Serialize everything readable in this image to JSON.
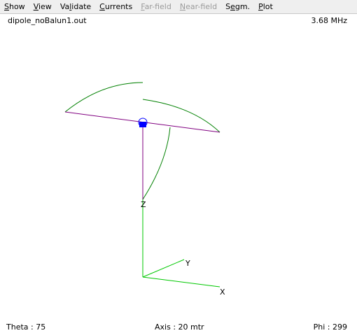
{
  "menu": [
    {
      "pre": "",
      "key": "S",
      "post": "how",
      "enabled": true,
      "name": "menu-show"
    },
    {
      "pre": "",
      "key": "V",
      "post": "iew",
      "enabled": true,
      "name": "menu-view"
    },
    {
      "pre": "Va",
      "key": "l",
      "post": "idate",
      "enabled": true,
      "name": "menu-validate"
    },
    {
      "pre": "",
      "key": "C",
      "post": "urrents",
      "enabled": true,
      "name": "menu-currents"
    },
    {
      "pre": "",
      "key": "F",
      "post": "ar-field",
      "enabled": false,
      "name": "menu-far-field"
    },
    {
      "pre": "",
      "key": "N",
      "post": "ear-field",
      "enabled": false,
      "name": "menu-near-field"
    },
    {
      "pre": "S",
      "key": "e",
      "post": "gm.",
      "enabled": true,
      "name": "menu-segm"
    },
    {
      "pre": "",
      "key": "P",
      "post": "lot",
      "enabled": true,
      "name": "menu-plot"
    }
  ],
  "header": {
    "file_name": "dipole_noBalun1.out",
    "frequency": "3.68 MHz"
  },
  "axes": {
    "x_label": "X",
    "y_label": "Y",
    "z_label": "Z"
  },
  "footer": {
    "theta": "Theta : 75",
    "axis": "Axis : 20 mtr",
    "phi": "Phi : 299"
  },
  "colors": {
    "wire": "#800080",
    "current": "#008000",
    "axis": "#00c800",
    "source": "#0000ff"
  }
}
